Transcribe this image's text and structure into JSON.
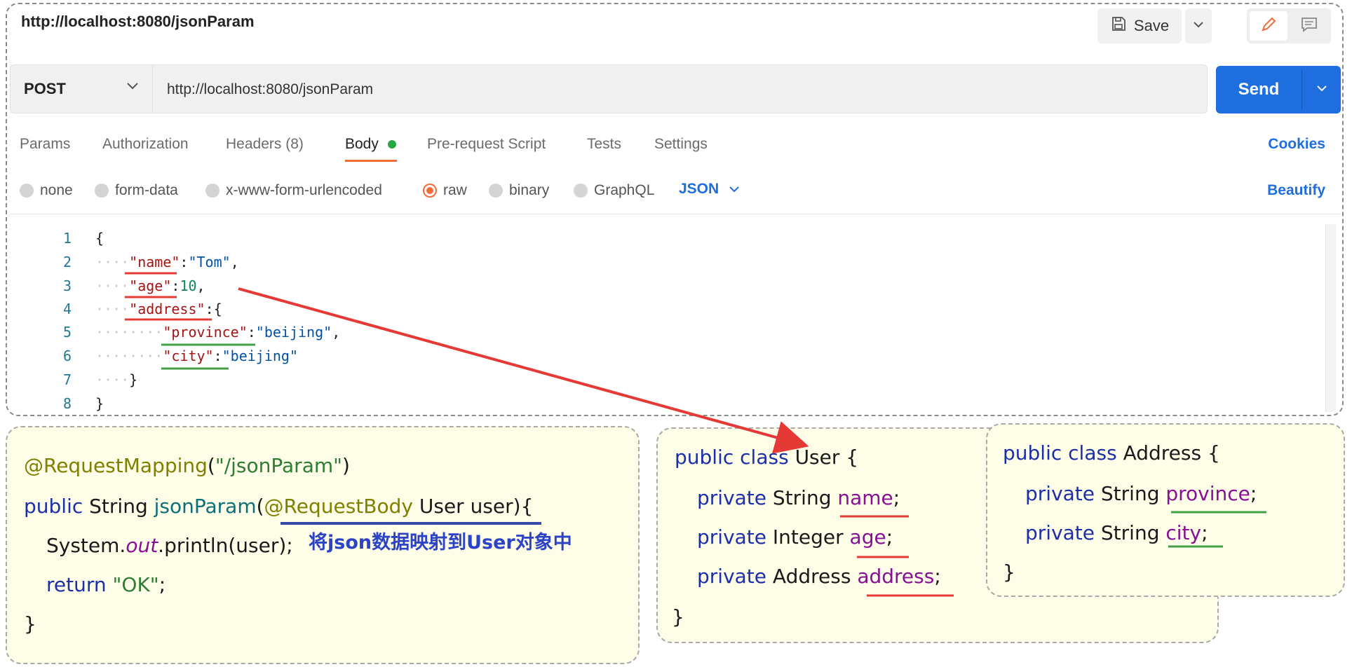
{
  "request": {
    "tab_title": "http://localhost:8080/jsonParam",
    "save_label": "Save",
    "method": "POST",
    "url": "http://localhost:8080/jsonParam",
    "send_label": "Send"
  },
  "tabs": [
    {
      "label": "Params"
    },
    {
      "label": "Authorization"
    },
    {
      "label": "Headers (8)"
    },
    {
      "label": "Body"
    },
    {
      "label": "Pre-request Script"
    },
    {
      "label": "Tests"
    },
    {
      "label": "Settings"
    }
  ],
  "cookies_label": "Cookies",
  "body_types": [
    {
      "label": "none"
    },
    {
      "label": "form-data"
    },
    {
      "label": "x-www-form-urlencoded"
    },
    {
      "label": "raw"
    },
    {
      "label": "binary"
    },
    {
      "label": "GraphQL"
    }
  ],
  "format": "JSON",
  "beautify_label": "Beautify",
  "line_numbers": [
    "1",
    "2",
    "3",
    "4",
    "5",
    "6",
    "7",
    "8"
  ],
  "json_body": {
    "name": "Tom",
    "age": "10",
    "address_key": "address",
    "province": "beijing",
    "city": "beijing"
  },
  "controller_code": {
    "annotation": "@RequestMapping",
    "path": "\"/jsonParam\"",
    "kw_public": "public",
    "return_type": "String",
    "method_name": "jsonParam",
    "param_annotation": "@RequestBody",
    "param": "User user",
    "print_prefix": "System.",
    "print_field": "out",
    "print_suffix": ".println(user);",
    "kw_return": "return",
    "return_value": "\"OK\"",
    "note": "将json数据映射到User对象中"
  },
  "user_class": {
    "header_kw": "public class",
    "name": "User",
    "fields": [
      {
        "type": "String",
        "name": "name"
      },
      {
        "type": "Integer",
        "name": "age"
      },
      {
        "type": "Address",
        "name": "address"
      }
    ]
  },
  "address_class": {
    "header_kw": "public class",
    "name": "Address",
    "fields": [
      {
        "type": "String",
        "name": "province"
      },
      {
        "type": "String",
        "name": "city"
      }
    ]
  },
  "colors": {
    "accent": "#1f6ee0",
    "tab_active": "#f26b3a",
    "red_underline": "#e53935",
    "green_underline": "#43a047",
    "blue_underline": "#3949ab"
  }
}
